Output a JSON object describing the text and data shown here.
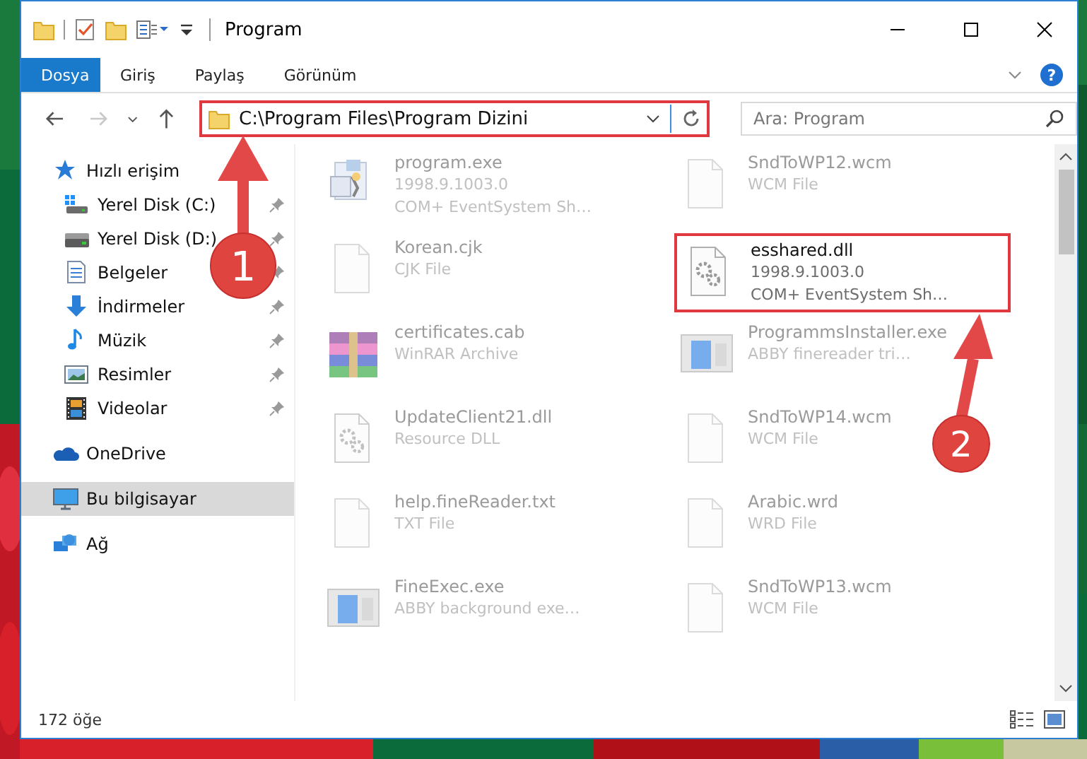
{
  "window": {
    "title": "Program"
  },
  "ribbon_tabs": [
    {
      "label": "Dosya",
      "kind": "file",
      "selected": false
    },
    {
      "label": "Giriş",
      "kind": "tab",
      "selected": false
    },
    {
      "label": "Paylaş",
      "kind": "tab",
      "selected": false
    },
    {
      "label": "Görünüm",
      "kind": "tab",
      "selected": false
    }
  ],
  "help": "?",
  "address": {
    "path": "C:\\Program Files\\Program Dizini",
    "highlighted": true
  },
  "search": {
    "placeholder": "Ara: Program"
  },
  "sidebar": {
    "items": [
      {
        "label": "Hızlı erişim",
        "selected": false,
        "children": [
          {
            "label": "Yerel Disk (C:)",
            "pinned": true,
            "selected": false
          },
          {
            "label": "Yerel Disk (D:)",
            "pinned": true,
            "selected": false
          },
          {
            "label": "Belgeler",
            "pinned": true,
            "selected": false
          },
          {
            "label": "İndirmeler",
            "pinned": true,
            "selected": false
          },
          {
            "label": "Müzik",
            "pinned": true,
            "selected": false
          },
          {
            "label": "Resimler",
            "pinned": true,
            "selected": false
          },
          {
            "label": "Videolar",
            "pinned": true,
            "selected": false
          }
        ]
      },
      {
        "label": "OneDrive",
        "selected": false
      },
      {
        "label": "Bu bilgisayar",
        "selected": true
      },
      {
        "label": "Ağ",
        "selected": false
      }
    ]
  },
  "files": [
    {
      "name": "program.exe",
      "kind": "program",
      "details": [
        "1998.9.1003.0",
        "COM+ EventSystem Sh…"
      ],
      "highlighted": false
    },
    {
      "name": "SndToWP12.wcm",
      "kind": "document",
      "details": [
        "WCM File"
      ],
      "highlighted": false
    },
    {
      "name": "Korean.cjk",
      "kind": "document",
      "details": [
        "CJK File"
      ],
      "highlighted": false
    },
    {
      "name": "esshared.dll",
      "kind": "library",
      "details": [
        "1998.9.1003.0",
        "COM+ EventSystem Sh…"
      ],
      "highlighted": true
    },
    {
      "name": "certificates.cab",
      "kind": "archive",
      "details": [
        "WinRAR Archive"
      ],
      "highlighted": false
    },
    {
      "name": "ProgrammsInstaller.exe",
      "kind": "window",
      "details": [
        "ABBY finereader tri…"
      ],
      "highlighted": false
    },
    {
      "name": "UpdateClient21.dll",
      "kind": "library",
      "details": [
        "Resource DLL"
      ],
      "highlighted": false
    },
    {
      "name": "SndToWP14.wcm",
      "kind": "document",
      "details": [
        "WCM File"
      ],
      "highlighted": false
    },
    {
      "name": "help.fineReader.txt",
      "kind": "document",
      "details": [
        "TXT File"
      ],
      "highlighted": false
    },
    {
      "name": "Arabic.wrd",
      "kind": "document",
      "details": [
        "WRD File"
      ],
      "highlighted": false
    },
    {
      "name": "FineExec.exe",
      "kind": "window",
      "details": [
        "ABBY background exe…"
      ],
      "highlighted": false
    },
    {
      "name": "SndToWP13.wcm",
      "kind": "document",
      "details": [
        "WCM File"
      ],
      "highlighted": false
    }
  ],
  "status_bar": {
    "count": "172 öğe"
  },
  "annotations": [
    {
      "number": "1"
    },
    {
      "number": "2"
    }
  ]
}
